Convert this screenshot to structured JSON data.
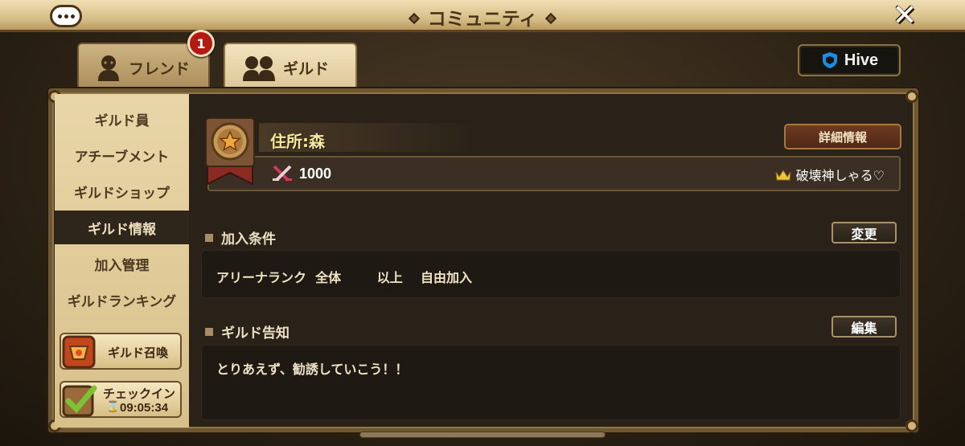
{
  "header": {
    "title": "コミュニティ",
    "close_icon": "✕"
  },
  "tabs": [
    {
      "label": "フレンド",
      "badge": "1",
      "active": false
    },
    {
      "label": "ギルド",
      "active": true
    }
  ],
  "hive": {
    "label": "Hive"
  },
  "sidebar": {
    "items": [
      {
        "label": "ギルド員"
      },
      {
        "label": "アチーブメント"
      },
      {
        "label": "ギルドショップ"
      },
      {
        "label": "ギルド情報",
        "active": true
      },
      {
        "label": "加入管理"
      },
      {
        "label": "ギルドランキング"
      }
    ],
    "summon_label": "ギルド召喚",
    "checkin_label": "チェックイン",
    "checkin_timer": "09:05:34"
  },
  "guild": {
    "address": "住所:森",
    "detail_label": "詳細情報",
    "score": "1000",
    "master": "破壊神しゃる♡"
  },
  "join": {
    "title": "加入条件",
    "change_label": "変更",
    "condition": "アリーナランク  全体        以上    自由加入"
  },
  "notice": {
    "title": "ギルド告知",
    "edit_label": "編集",
    "text": "とりあえず、勧誘していこう！！"
  },
  "colors": {
    "accent_gold": "#f6e89c",
    "badge_red": "#b51a12",
    "panel_dark": "#2a2219"
  }
}
